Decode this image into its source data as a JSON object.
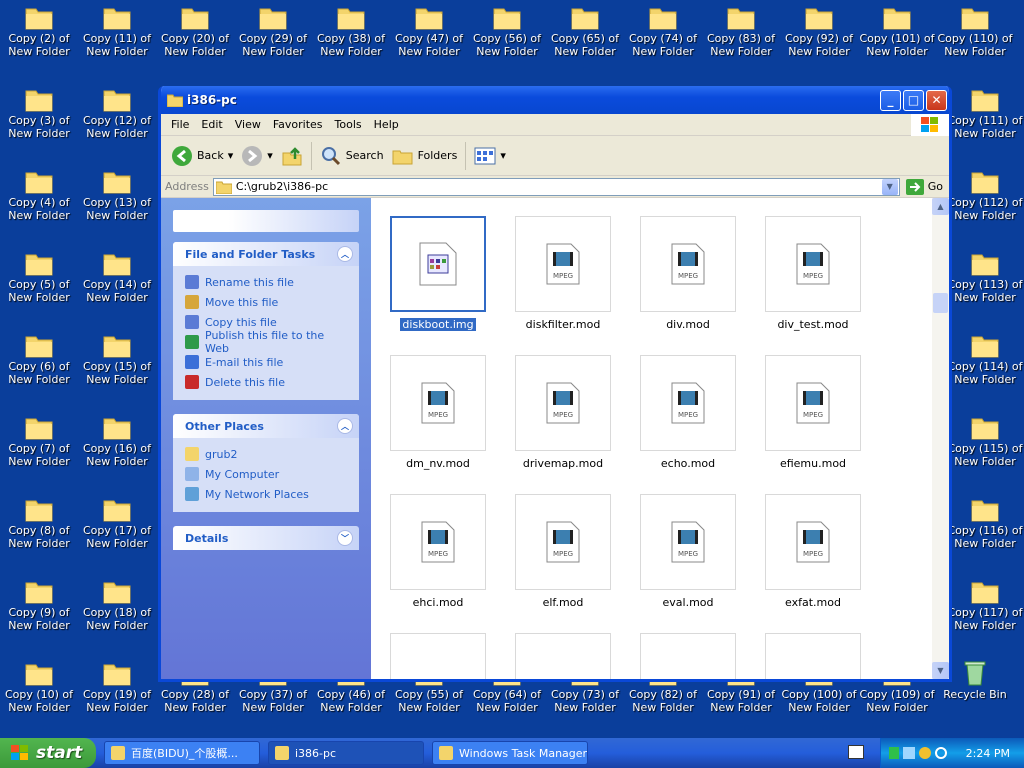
{
  "desktop": {
    "icons": [
      {
        "label": "Copy (2) of\nNew Folder"
      },
      {
        "label": "Copy (11) of\nNew Folder"
      },
      {
        "label": "Copy (20) of\nNew Folder"
      },
      {
        "label": "Copy (29) of\nNew Folder"
      },
      {
        "label": "Copy (38) of\nNew Folder"
      },
      {
        "label": "Copy (47) of\nNew Folder"
      },
      {
        "label": "Copy (56) of\nNew Folder"
      },
      {
        "label": "Copy (65) of\nNew Folder"
      },
      {
        "label": "Copy (74) of\nNew Folder"
      },
      {
        "label": "Copy (83) of\nNew Folder"
      },
      {
        "label": "Copy (92) of\nNew Folder"
      },
      {
        "label": "Copy (101) of\nNew Folder"
      },
      {
        "label": "Copy (110) of\nNew Folder"
      },
      {
        "label": "Copy (3) of\nNew Folder"
      },
      {
        "label": "Copy (12) of\nNew Folder"
      },
      {
        "label": "Copy (111) of\nNew Folder"
      },
      {
        "label": "Copy (4) of\nNew Folder"
      },
      {
        "label": "Copy (13) of\nNew Folder"
      },
      {
        "label": "Copy (112) of\nNew Folder"
      },
      {
        "label": "Copy (5) of\nNew Folder"
      },
      {
        "label": "Copy (14) of\nNew Folder"
      },
      {
        "label": "Copy (113) of\nNew Folder"
      },
      {
        "label": "Copy (6) of\nNew Folder"
      },
      {
        "label": "Copy (15) of\nNew Folder"
      },
      {
        "label": "Copy (114) of\nNew Folder"
      },
      {
        "label": "Copy (7) of\nNew Folder"
      },
      {
        "label": "Copy (16) of\nNew Folder"
      },
      {
        "label": "Copy (115) of\nNew Folder"
      },
      {
        "label": "Copy (8) of\nNew Folder"
      },
      {
        "label": "Copy (17) of\nNew Folder"
      },
      {
        "label": "Copy (116) of\nNew Folder"
      },
      {
        "label": "Copy (9) of\nNew Folder"
      },
      {
        "label": "Copy (18) of\nNew Folder"
      },
      {
        "label": "Copy (117) of\nNew Folder"
      },
      {
        "label": "Copy (10) of\nNew Folder"
      },
      {
        "label": "Copy (19) of\nNew Folder"
      },
      {
        "label": "Copy (28) of\nNew Folder"
      },
      {
        "label": "Copy (37) of\nNew Folder"
      },
      {
        "label": "Copy (46) of\nNew Folder"
      },
      {
        "label": "Copy (55) of\nNew Folder"
      },
      {
        "label": "Copy (64) of\nNew Folder"
      },
      {
        "label": "Copy (73) of\nNew Folder"
      },
      {
        "label": "Copy (82) of\nNew Folder"
      },
      {
        "label": "Copy (91) of\nNew Folder"
      },
      {
        "label": "Copy (100) of\nNew Folder"
      },
      {
        "label": "Copy (109) of\nNew Folder"
      },
      {
        "label": "Recycle Bin",
        "icon": "recycle-bin-icon"
      }
    ]
  },
  "window": {
    "title": "i386-pc",
    "menu": [
      "File",
      "Edit",
      "View",
      "Favorites",
      "Tools",
      "Help"
    ],
    "toolbar": {
      "back": "Back",
      "search": "Search",
      "folders": "Folders"
    },
    "address": {
      "label": "Address",
      "value": "C:\\grub2\\i386-pc",
      "go": "Go"
    },
    "tasks_title": "File and Folder Tasks",
    "tasks": [
      "Rename this file",
      "Move this file",
      "Copy this file",
      "Publish this file to the Web",
      "E-mail this file",
      "Delete this file"
    ],
    "other_title": "Other Places",
    "other": [
      "grub2",
      "My Computer",
      "My Network Places"
    ],
    "details_title": "Details",
    "files": [
      {
        "name": "diskboot.img",
        "type": "img",
        "selected": true
      },
      {
        "name": "diskfilter.mod",
        "type": "mpeg"
      },
      {
        "name": "div.mod",
        "type": "mpeg"
      },
      {
        "name": "div_test.mod",
        "type": "mpeg"
      },
      {
        "name": "dm_nv.mod",
        "type": "mpeg"
      },
      {
        "name": "drivemap.mod",
        "type": "mpeg"
      },
      {
        "name": "echo.mod",
        "type": "mpeg"
      },
      {
        "name": "efiemu.mod",
        "type": "mpeg"
      },
      {
        "name": "ehci.mod",
        "type": "mpeg"
      },
      {
        "name": "elf.mod",
        "type": "mpeg"
      },
      {
        "name": "eval.mod",
        "type": "mpeg"
      },
      {
        "name": "exfat.mod",
        "type": "mpeg"
      }
    ],
    "mpeg_label": "MPEG"
  },
  "taskbar": {
    "start": "start",
    "tasks": [
      {
        "label": "百度(BIDU)_个股概...",
        "icon": "ie-icon"
      },
      {
        "label": "i386-pc",
        "icon": "folder-icon",
        "active": true
      },
      {
        "label": "Windows Task Manager",
        "icon": "task-manager-icon"
      }
    ],
    "clock": "2:24 PM"
  },
  "colors": {
    "desktop": "#0a3e9b",
    "titlebar": "#0a4bdc",
    "selection": "#316ac5"
  }
}
